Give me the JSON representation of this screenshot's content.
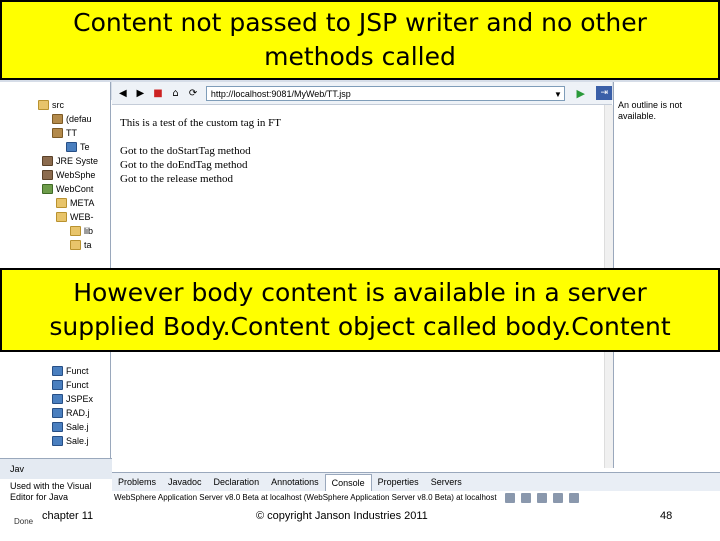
{
  "banners": {
    "top_line1": "Content not passed to JSP writer and no other",
    "top_line2": "methods called",
    "mid_line1": "However body content is available in a server",
    "mid_line2": "supplied Body.Content object called body.Content"
  },
  "project_tree": {
    "items": [
      {
        "label": "src",
        "icon": "folder-icon"
      },
      {
        "label": "(defau",
        "icon": "package-icon"
      },
      {
        "label": "TT",
        "icon": "package-icon"
      },
      {
        "label": "Te",
        "icon": "java-file-icon"
      },
      {
        "label": "JRE Syste",
        "icon": "jar-icon"
      },
      {
        "label": "WebSphe",
        "icon": "jar-icon"
      },
      {
        "label": "WebCont",
        "icon": "web-folder-icon"
      },
      {
        "label": "META",
        "icon": "folder-icon"
      },
      {
        "label": "WEB-",
        "icon": "folder-icon"
      },
      {
        "label": "lib",
        "icon": "folder-icon"
      },
      {
        "label": "ta",
        "icon": "folder-icon"
      },
      {
        "label": "Funct",
        "icon": "java-file-icon"
      },
      {
        "label": "Funct",
        "icon": "java-file-icon"
      },
      {
        "label": "JSPEx",
        "icon": "java-file-icon"
      },
      {
        "label": "RAD.j",
        "icon": "java-file-icon"
      },
      {
        "label": "Sale.j",
        "icon": "java-file-icon"
      },
      {
        "label": "Sale.j",
        "icon": "java-file-icon"
      }
    ]
  },
  "browser": {
    "url": "http://localhost:9081/MyWeb/TT.jsp",
    "lines": [
      "This is a test of the custom tag in FT",
      "Got to the doStartTag method",
      "Got to the doEndTag method",
      "Got to the release method"
    ]
  },
  "outline": {
    "message": "An outline is not available."
  },
  "bottom_left": {
    "tab": "Jav",
    "text": "Used with the Visual Editor for Java"
  },
  "console": {
    "tabs": [
      "Problems",
      "Javadoc",
      "Declaration",
      "Annotations",
      "Console",
      "Properties",
      "Servers"
    ],
    "active_tab": "Console",
    "line": "WebSphere Application Server v8.0 Beta at localhost (WebSphere Application Server v8.0 Beta) at localhost"
  },
  "status": {
    "done": "Done"
  },
  "footer": {
    "chapter": "chapter 11",
    "copyright": "© copyright Janson Industries 2011",
    "page": "48"
  },
  "colors": {
    "banner": "#ffff00",
    "ide_chrome": "#d6dde8"
  }
}
